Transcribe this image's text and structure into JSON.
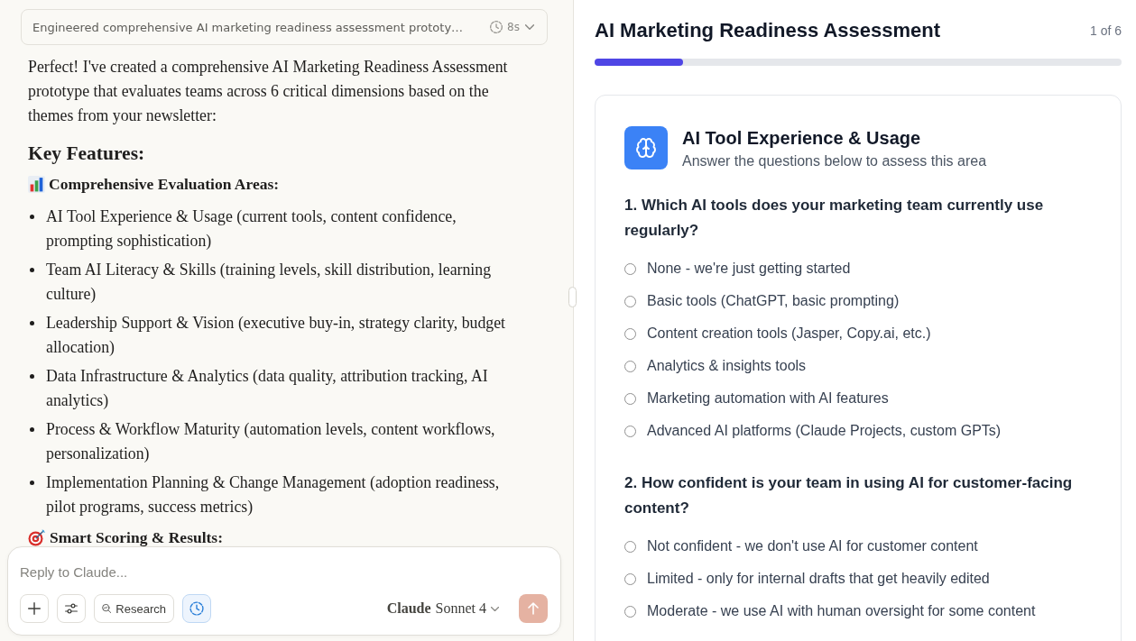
{
  "chat": {
    "thinking": {
      "summary": "Engineered comprehensive AI marketing readiness assessment prototy…",
      "duration": "8s"
    },
    "intro": "Perfect! I've created a comprehensive AI Marketing Readiness Assessment prototype that evaluates teams across 6 critical dimensions based on the themes from your newsletter:",
    "heading": "Key Features:",
    "sections": [
      {
        "title": "Comprehensive Evaluation Areas:",
        "items": [
          "AI Tool Experience & Usage (current tools, content confidence, prompting sophistication)",
          "Team AI Literacy & Skills (training levels, skill distribution, learning culture)",
          "Leadership Support & Vision (executive buy-in, strategy clarity, budget allocation)",
          "Data Infrastructure & Analytics (data quality, attribution tracking, AI analytics)",
          "Process & Workflow Maturity (automation levels, content workflows, personalization)",
          "Implementation Planning & Change Management (adoption readiness, pilot programs, success metrics)"
        ]
      },
      {
        "title": "Smart Scoring & Results:"
      }
    ],
    "composer": {
      "placeholder": "Reply to Claude...",
      "tools": [
        {
          "kind": "add"
        },
        {
          "kind": "settings"
        },
        {
          "kind": "research",
          "label": "Research",
          "on": false
        },
        {
          "kind": "timer",
          "on": true
        }
      ],
      "model": "**Claude** Sonnet 4",
      "send": {
        "disabled": true
      }
    }
  },
  "assessment": {
    "title": "AI Marketing Readiness Assessment",
    "step": "1 of 6",
    "progress": {
      "level": 0.167
    },
    "section": {
      "title": "AI Tool Experience & Usage",
      "subtitle": "Answer the questions below to assess this area"
    },
    "questions": [
      {
        "text": "1. Which AI tools does your marketing team currently use regularly?",
        "options": [
          {
            "label": "None - we're just getting started",
            "selected": false
          },
          {
            "label": "Basic tools (ChatGPT, basic prompting)",
            "selected": false
          },
          {
            "label": "Content creation tools (Jasper, Copy.ai, etc.)",
            "selected": false
          },
          {
            "label": "Analytics & insights tools",
            "selected": false
          },
          {
            "label": "Marketing automation with AI features",
            "selected": false
          },
          {
            "label": "Advanced AI platforms (Claude Projects, custom GPTs)",
            "selected": false
          }
        ]
      },
      {
        "text": "2. How confident is your team in using AI for customer-facing content?",
        "options": [
          {
            "label": "Not confident - we don't use AI for customer content",
            "selected": false
          },
          {
            "label": "Limited - only for internal drafts that get heavily edited",
            "selected": false
          },
          {
            "label": "Moderate - we use AI with human oversight for some content",
            "selected": false
          }
        ]
      }
    ]
  }
}
